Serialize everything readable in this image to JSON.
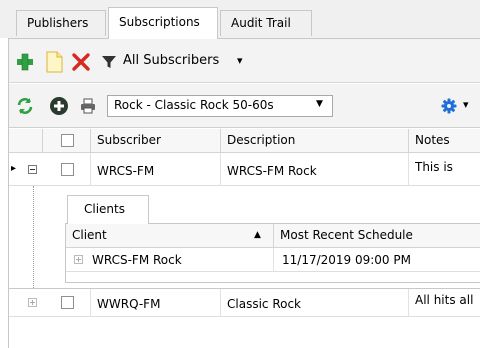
{
  "tabs": [
    {
      "label": "Publishers",
      "active": false
    },
    {
      "label": "Subscriptions",
      "active": true
    },
    {
      "label": "Audit Trail",
      "active": false
    }
  ],
  "toolbar1": {
    "add_icon": "green-plus-icon",
    "new_icon": "new-document-icon",
    "delete_icon": "red-x-icon",
    "filter_icon": "funnel-filter-icon",
    "filter_label": "All Subscribers",
    "filter_caret": "▾"
  },
  "toolbar2": {
    "refresh_icon": "green-refresh-icon",
    "add_icon": "circle-plus-icon",
    "print_icon": "printer-icon",
    "schedule_value": "Rock - Classic Rock 50-60s",
    "schedule_caret": "▼",
    "settings_icon": "gear-icon",
    "settings_caret": "▾"
  },
  "grid": {
    "columns": [
      "Subscriber",
      "Description",
      "Notes"
    ],
    "rows": [
      {
        "subscriber": "WRCS-FM",
        "description": "WRCS-FM Rock",
        "notes": "This is",
        "expanded": true,
        "current": true,
        "indicator": "▸"
      },
      {
        "subscriber": "WWRQ-FM",
        "description": "Classic Rock",
        "notes": "All hits all",
        "expanded": false,
        "current": false
      }
    ]
  },
  "detail": {
    "tab_label": "Clients",
    "columns": [
      "Client",
      "Most Recent Schedule"
    ],
    "sort_indicator": "▲",
    "rows": [
      {
        "client": "WRCS-FM Rock",
        "schedule": "11/17/2019 09:00 PM"
      }
    ]
  },
  "colors": {
    "accent": "#1e6fd9",
    "add_green": "#2fa043",
    "delete_red": "#d9281f"
  }
}
